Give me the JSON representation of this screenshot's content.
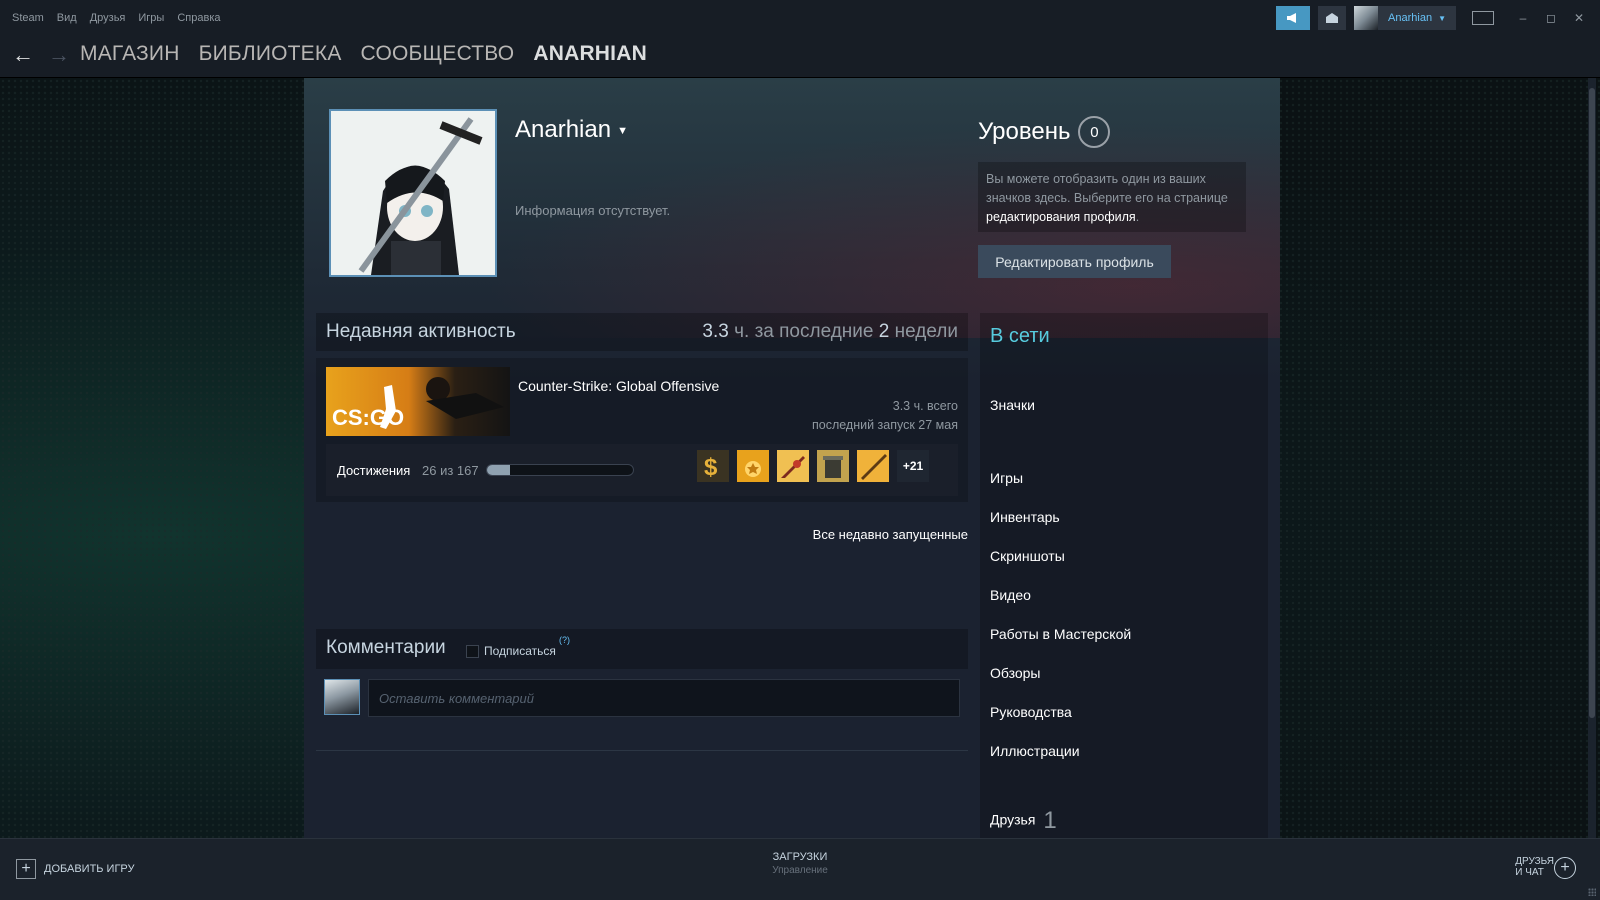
{
  "menu": [
    "Steam",
    "Вид",
    "Друзья",
    "Игры",
    "Справка"
  ],
  "topbar": {
    "username": "Anarhian"
  },
  "nav": {
    "links": [
      "МАГАЗИН",
      "БИБЛИОТЕКА",
      "СООБЩЕСТВО",
      "ANARHIAN"
    ],
    "active_index": 3
  },
  "profile": {
    "name": "Anarhian",
    "summary": "Информация отсутствует.",
    "level_label": "Уровень",
    "level": "0",
    "badge_hint_prefix": "Вы можете отобразить один из ваших значков здесь. Выберите его на странице ",
    "badge_hint_link": "редактирования профиля",
    "badge_hint_suffix": ".",
    "edit_button": "Редактировать профиль"
  },
  "recent_activity": {
    "title": "Недавняя активность",
    "hours": "3.3",
    "hours_suffix": "ч. за последние",
    "weeks": "2",
    "weeks_suffix": "недели",
    "game": {
      "name": "Counter-Strike: Global Offensive",
      "capsule_text": "CS:GO",
      "total": "3.3 ч. всего",
      "last_played": "последний запуск 27 мая",
      "achievements_label": "Достижения",
      "achievements_count": "26 из 167",
      "achievements_progress": 0.156,
      "more_achievements": "+21",
      "achievement_icons": [
        "dollar-achievement-icon",
        "ten-star-achievement-icon",
        "knife-achievement-icon",
        "grenade-achievement-icon",
        "rifle-achievement-icon"
      ]
    },
    "all_recent_link": "Все недавно запущенные"
  },
  "comments": {
    "title": "Комментарии",
    "subscribe": "Подписаться",
    "help": "(?)",
    "placeholder": "Оставить комментарий"
  },
  "sidebar": {
    "status": "В сети",
    "badges": "Значки",
    "links": [
      "Игры",
      "Инвентарь",
      "Скриншоты",
      "Видео",
      "Работы в Мастерской",
      "Обзоры",
      "Руководства",
      "Иллюстрации"
    ],
    "friends": "Друзья",
    "friends_count": "1"
  },
  "bottom": {
    "add_game": "ДОБАВИТЬ ИГРУ",
    "downloads": "ЗАГРУЗКИ",
    "downloads_sub": "Управление",
    "friends_chat_line1": "ДРУЗЬЯ",
    "friends_chat_line2": "И ЧАТ"
  },
  "colors": {
    "accent": "#67c1f5",
    "online": "#57cbde",
    "announce": "#4798c2",
    "avatar_border": "#5c90b6"
  }
}
